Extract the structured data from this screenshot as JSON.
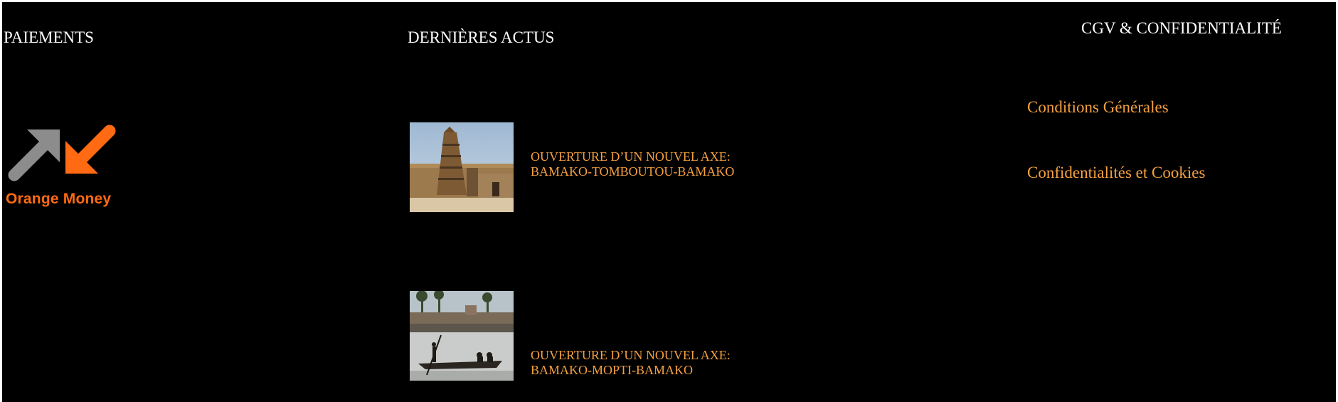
{
  "columns": {
    "payments": {
      "title": "PAIEMENTS",
      "logo": {
        "name": "orange-money-logo",
        "text": "Orange Money",
        "colors": {
          "gray": "#8c8c8c",
          "orange": "#ff6a13"
        }
      }
    },
    "news": {
      "title": "DERNIÈRES ACTUS",
      "items": [
        {
          "line1": "OUVERTURE D’UN NOUVEL AXE:",
          "line2": "BAMAKO-TOMBOUTOU-BAMAKO",
          "thumbnail": "mosque-photo"
        },
        {
          "line1": "OUVERTURE D’UN NOUVEL AXE:",
          "line2": "BAMAKO-MOPTI-BAMAKO",
          "thumbnail": "river-canoe-photo"
        }
      ]
    },
    "legal": {
      "title": "CGV & CONFIDENTIALITÉ",
      "links": [
        "Conditions Générales",
        "Confidentialités et Cookies"
      ]
    }
  },
  "colors": {
    "background": "#000000",
    "heading": "#ffffff",
    "link": "#f5a040"
  }
}
